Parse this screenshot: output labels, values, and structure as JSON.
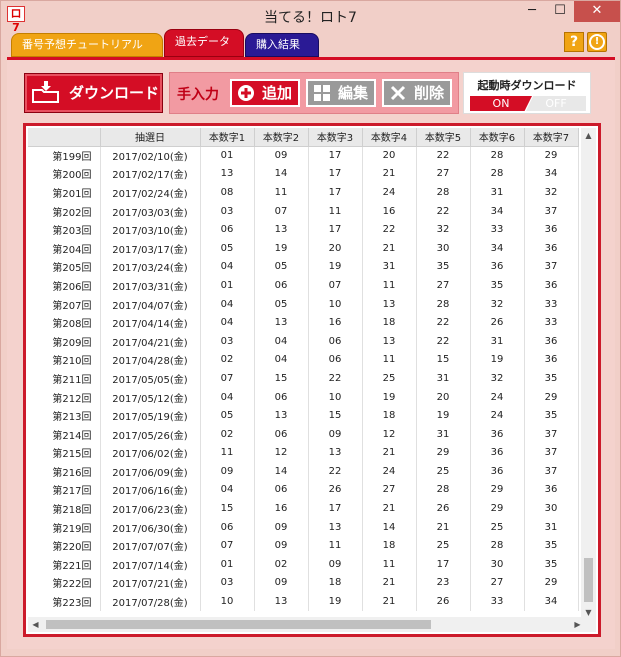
{
  "window": {
    "title": "当てる！ロト7",
    "app_icon_text": "ロ7",
    "minimize": "─",
    "maximize": "☐",
    "close": "✕"
  },
  "tabs": [
    {
      "label": "番号予想チュートリアル"
    },
    {
      "label": "過去データ"
    },
    {
      "label": "購入結果"
    }
  ],
  "header_buttons": {
    "help": "?",
    "info": "!"
  },
  "toolbar": {
    "download_label": "ダウンロード",
    "manual_label": "手入力",
    "add_label": "追加",
    "edit_label": "編集",
    "delete_label": "削除",
    "startup_label": "起動時ダウンロード",
    "toggle_on": "ON",
    "toggle_off": "OFF"
  },
  "table": {
    "headers": [
      "",
      "抽選日",
      "本数字1",
      "本数字2",
      "本数字3",
      "本数字4",
      "本数字5",
      "本数字6",
      "本数字7"
    ],
    "rows": [
      [
        "第199回",
        "2017/02/10(金)",
        "01",
        "09",
        "17",
        "20",
        "22",
        "28",
        "29"
      ],
      [
        "第200回",
        "2017/02/17(金)",
        "13",
        "14",
        "17",
        "21",
        "27",
        "28",
        "34"
      ],
      [
        "第201回",
        "2017/02/24(金)",
        "08",
        "11",
        "17",
        "24",
        "28",
        "31",
        "32"
      ],
      [
        "第202回",
        "2017/03/03(金)",
        "03",
        "07",
        "11",
        "16",
        "22",
        "34",
        "37"
      ],
      [
        "第203回",
        "2017/03/10(金)",
        "06",
        "13",
        "17",
        "22",
        "32",
        "33",
        "36"
      ],
      [
        "第204回",
        "2017/03/17(金)",
        "05",
        "19",
        "20",
        "21",
        "30",
        "34",
        "36"
      ],
      [
        "第205回",
        "2017/03/24(金)",
        "04",
        "05",
        "19",
        "31",
        "35",
        "36",
        "37"
      ],
      [
        "第206回",
        "2017/03/31(金)",
        "01",
        "06",
        "07",
        "11",
        "27",
        "35",
        "36"
      ],
      [
        "第207回",
        "2017/04/07(金)",
        "04",
        "05",
        "10",
        "13",
        "28",
        "32",
        "33"
      ],
      [
        "第208回",
        "2017/04/14(金)",
        "04",
        "13",
        "16",
        "18",
        "22",
        "26",
        "33"
      ],
      [
        "第209回",
        "2017/04/21(金)",
        "03",
        "04",
        "06",
        "13",
        "22",
        "31",
        "36"
      ],
      [
        "第210回",
        "2017/04/28(金)",
        "02",
        "04",
        "06",
        "11",
        "15",
        "19",
        "36"
      ],
      [
        "第211回",
        "2017/05/05(金)",
        "07",
        "15",
        "22",
        "25",
        "31",
        "32",
        "35"
      ],
      [
        "第212回",
        "2017/05/12(金)",
        "04",
        "06",
        "10",
        "19",
        "20",
        "24",
        "29"
      ],
      [
        "第213回",
        "2017/05/19(金)",
        "05",
        "13",
        "15",
        "18",
        "19",
        "24",
        "35"
      ],
      [
        "第214回",
        "2017/05/26(金)",
        "02",
        "06",
        "09",
        "12",
        "31",
        "36",
        "37"
      ],
      [
        "第215回",
        "2017/06/02(金)",
        "11",
        "12",
        "13",
        "21",
        "29",
        "36",
        "37"
      ],
      [
        "第216回",
        "2017/06/09(金)",
        "09",
        "14",
        "22",
        "24",
        "25",
        "36",
        "37"
      ],
      [
        "第217回",
        "2017/06/16(金)",
        "04",
        "06",
        "26",
        "27",
        "28",
        "29",
        "36"
      ],
      [
        "第218回",
        "2017/06/23(金)",
        "15",
        "16",
        "17",
        "21",
        "26",
        "29",
        "30"
      ],
      [
        "第219回",
        "2017/06/30(金)",
        "06",
        "09",
        "13",
        "14",
        "21",
        "25",
        "31"
      ],
      [
        "第220回",
        "2017/07/07(金)",
        "07",
        "09",
        "11",
        "18",
        "25",
        "28",
        "35"
      ],
      [
        "第221回",
        "2017/07/14(金)",
        "01",
        "02",
        "09",
        "11",
        "17",
        "30",
        "35"
      ],
      [
        "第222回",
        "2017/07/21(金)",
        "03",
        "09",
        "18",
        "21",
        "23",
        "27",
        "29"
      ],
      [
        "第223回",
        "2017/07/28(金)",
        "10",
        "13",
        "19",
        "21",
        "26",
        "33",
        "34"
      ]
    ]
  },
  "scroll": {
    "up": "▲",
    "down": "▼",
    "left": "◀",
    "right": "▶"
  },
  "colors": {
    "accent": "#d40d25",
    "tab_tutorial": "#f0a414",
    "tab_purchase": "#2a1a95"
  }
}
